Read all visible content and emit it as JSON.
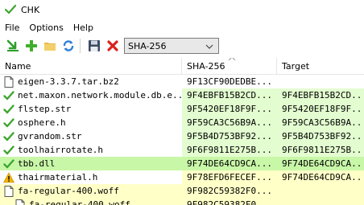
{
  "window": {
    "title": "CHK",
    "icon": "check-icon"
  },
  "menu": [
    "File",
    "Options",
    "Help"
  ],
  "toolbar": {
    "buttons": [
      {
        "name": "verify-button",
        "icon": "download-arrow-icon"
      },
      {
        "name": "add-button",
        "icon": "plus-icon"
      },
      {
        "name": "open-folder-button",
        "icon": "folder-icon"
      },
      {
        "name": "refresh-button",
        "icon": "refresh-icon"
      },
      {
        "name": "save-button",
        "icon": "floppy-icon"
      },
      {
        "name": "remove-button",
        "icon": "red-x-icon"
      }
    ],
    "algorithm": "SHA-256"
  },
  "columns": {
    "name": "Name",
    "sha": "SHA-256",
    "target": "Target"
  },
  "colors": {
    "ok": "#e3fdd0",
    "match": "#c8f7a8",
    "warn": "#ffffc8",
    "check": "#3fa52f",
    "warn_icon": "#f2b400"
  },
  "rows": [
    {
      "name": "eigen-3.3.7.tar.bz2",
      "sha": "9F13CF90DEDBE...",
      "target": "",
      "icon": "file-icon",
      "status": "plain"
    },
    {
      "name": "net.maxon.network.module.db.e...",
      "sha": "9F4EBFB15B2CD...",
      "target": "9F4EBFB15B2CD...",
      "icon": "check-icon",
      "status": "ok"
    },
    {
      "name": "flstep.str",
      "sha": "9F5420EF18F9F...",
      "target": "9F5420EF18F9F...",
      "icon": "check-icon",
      "status": "ok"
    },
    {
      "name": "osphere.h",
      "sha": "9F59CA3C56B9A...",
      "target": "9F59CA3C56B9A...",
      "icon": "check-icon",
      "status": "ok"
    },
    {
      "name": "gvrandom.str",
      "sha": "9F5B4D753BF92...",
      "target": "9F5B4D753BF92...",
      "icon": "check-icon",
      "status": "ok"
    },
    {
      "name": "toolhairrotate.h",
      "sha": "9F6F9811E275B...",
      "target": "9F6F9811E275B...",
      "icon": "check-icon",
      "status": "ok"
    },
    {
      "name": "tbb.dll",
      "sha": "9F74DE64CD9CA...",
      "target": "9F74DE64CD9CA...",
      "icon": "check-icon",
      "status": "match"
    },
    {
      "name": "thairmaterial.h",
      "sha": "9F78EFD6FECEF...",
      "target": "9F74DE64CD9CA...",
      "icon": "warning-icon",
      "status": "warn"
    },
    {
      "name": "fa-regular-400.woff",
      "sha": "9F982C59382F0...",
      "target": "",
      "icon": "file-icon",
      "status": "dup"
    },
    {
      "name": "fa-regular-400.woff",
      "sha": "9F982C59382F0...",
      "target": "",
      "icon": "file-icon",
      "status": "dup-child"
    }
  ]
}
